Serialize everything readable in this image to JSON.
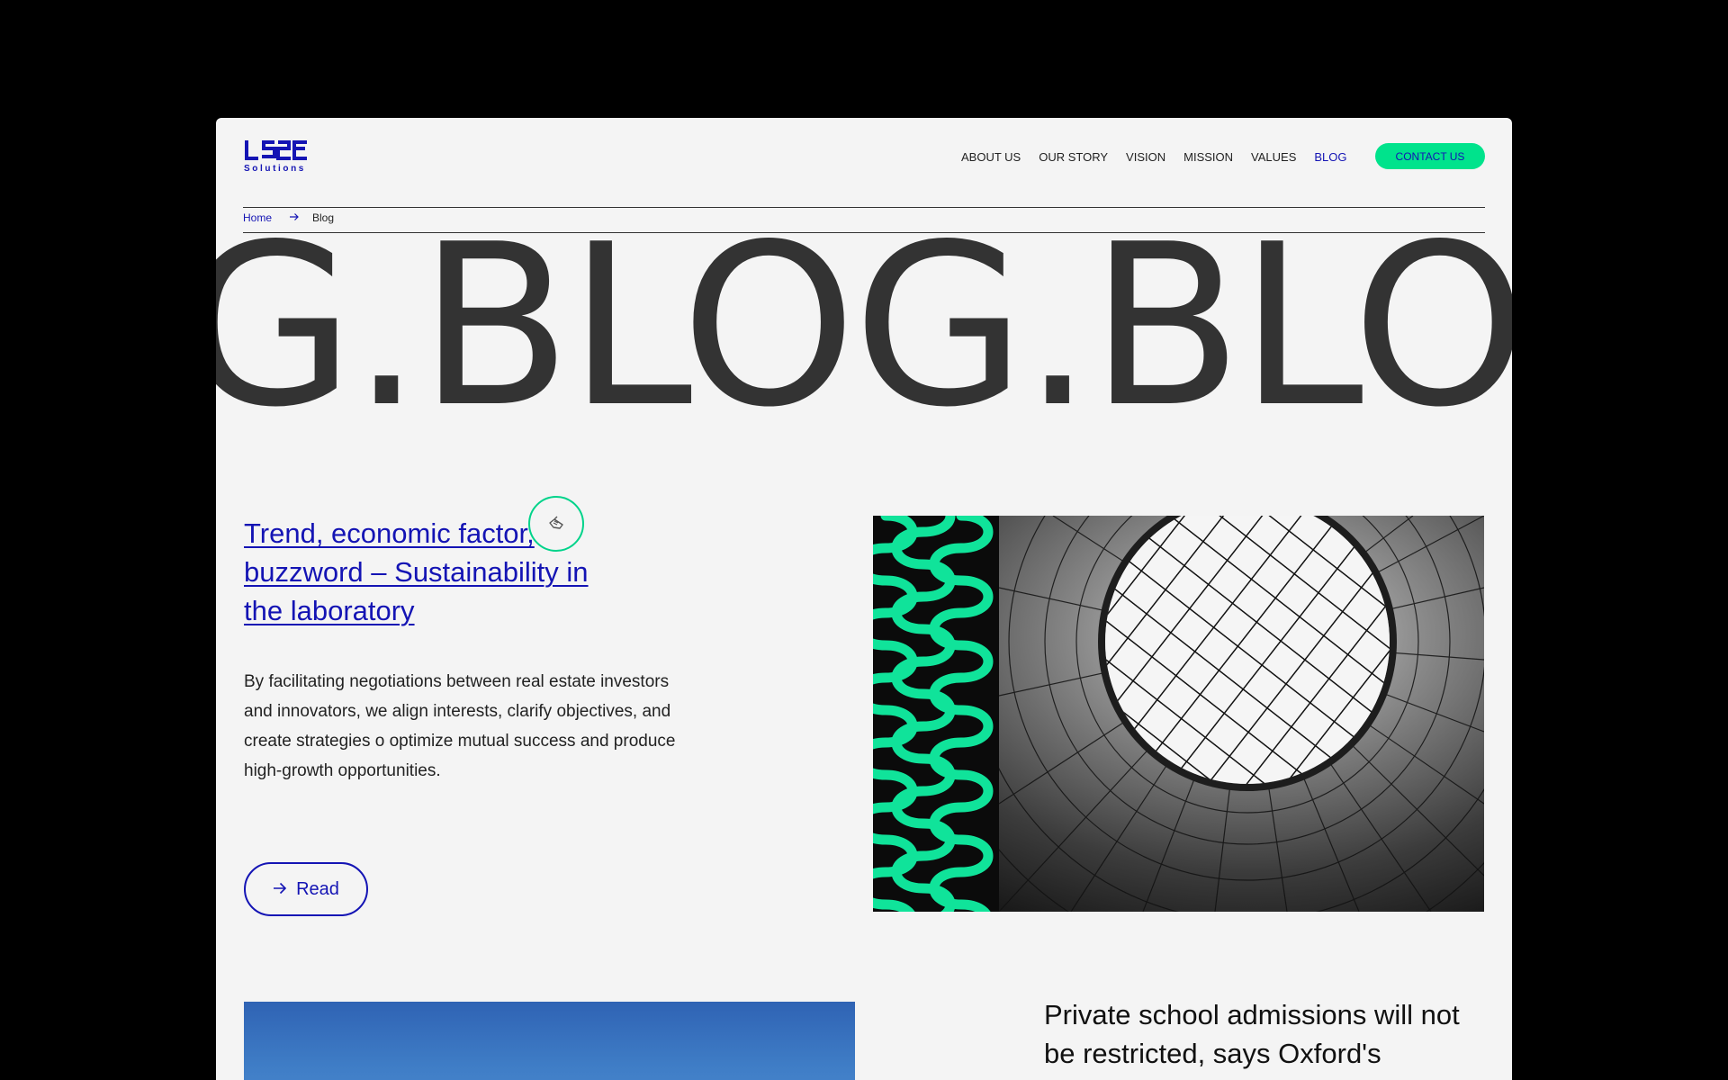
{
  "brand": {
    "logo_text": "LS2E",
    "logo_sub": "Solutions",
    "accent": "#1414b4",
    "highlight": "#00e38c",
    "text_dark": "#333333"
  },
  "nav": {
    "items": [
      {
        "label": "ABOUT US",
        "active": false
      },
      {
        "label": "OUR STORY",
        "active": false
      },
      {
        "label": "VISION",
        "active": false
      },
      {
        "label": "MISSION",
        "active": false
      },
      {
        "label": "VALUES",
        "active": false
      },
      {
        "label": "BLOG",
        "active": true
      }
    ],
    "contact_label": "CONTACT US"
  },
  "breadcrumb": {
    "home": "Home",
    "current": "Blog"
  },
  "hero": {
    "marquee_text": "G.BLOG.BLO"
  },
  "featured_post": {
    "title": "Trend, economic factor, buzzword – Sustainability in the laboratory",
    "excerpt": "By facilitating negotiations between real estate investors and innovators, we align interests, clarify objectives, and create strategies o optimize mutual success and produce high-growth opportunities.",
    "read_label": "Read"
  },
  "second_post": {
    "title": "Private school admissions will not be restricted, says Oxford's"
  }
}
